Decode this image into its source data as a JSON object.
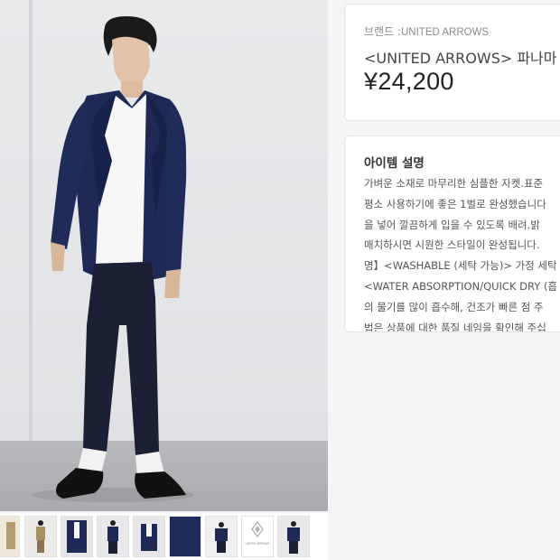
{
  "product": {
    "brand_label": "브랜드 :",
    "brand_name": "UNITED ARROWS",
    "name": "<UNITED ARROWS> 파나마 저",
    "price": "¥24,200"
  },
  "description": {
    "title": "아이템 설명",
    "lines": [
      "가벼운 소재로 마무리한 심플한 자켓.표준",
      "평소 사용하기에 좋은 1벌로 완성했습니다",
      "을 넣어 깔끔하게 입을 수 있도록 배려.밝",
      "매치하시면 시원한 스타일이 완성됩니다.",
      "명】<WASHABLE (세탁 가능)> 가정 세탁",
      "<WATER ABSORPTION/QUICK DRY (흡",
      "의 물기를 많이 흡수해, 건조가 빠른 점 주",
      "법은 상품에 대한 품질 네임을 확인해 주십"
    ]
  },
  "gallery": {
    "thumbnails": [
      "thumb-1",
      "thumb-2",
      "thumb-3",
      "thumb-4",
      "thumb-5",
      "thumb-6",
      "thumb-7",
      "thumb-8",
      "thumb-9"
    ],
    "thumb_logo_text": "UNITED ARROWS"
  },
  "colors": {
    "jacket": "#1e2a55",
    "trousers": "#1b2034",
    "price_text": "#222222",
    "panel_border": "#e3e4e8"
  }
}
